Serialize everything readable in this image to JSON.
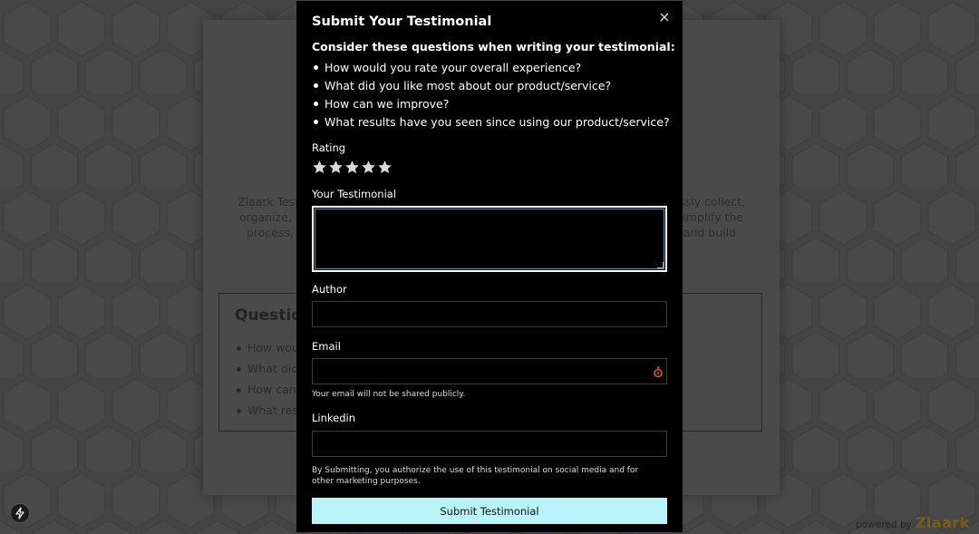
{
  "background_page": {
    "intro_text": "Zlaark Test                                                                         essly collect, organize, a                                                                   implify the process, y                                                                 and build",
    "intro_lines": [
      "Zlaark Test",
      "essly collect,",
      "organize, a",
      "implify the",
      "process, y",
      "and build"
    ],
    "questions_title": "Question",
    "questions": [
      "How wou",
      "What did",
      "How can",
      "What res"
    ]
  },
  "modal": {
    "title": "Submit Your Testimonial",
    "close_icon": "×",
    "questions_heading": "Consider these questions when writing your testimonial:",
    "questions": [
      "How would you rate your overall experience?",
      "What did you like most about our product/service?",
      "How can we improve?",
      "What results have you seen since using our product/service?"
    ],
    "rating_label": "Rating",
    "rating": {
      "value": 5,
      "max": 5
    },
    "testimonial_label": "Your Testimonial",
    "testimonial_value": "",
    "author_label": "Author",
    "author_value": "",
    "email_label": "Email",
    "email_value": "",
    "email_hint": "Your email will not be shared publicly.",
    "linkedin_label": "Linkedin",
    "linkedin_value": "",
    "legal_text": "By Submitting, you authorize the use of this testimonial on social media and for other marketing purposes.",
    "submit_label": "Submit Testimonial"
  },
  "footer": {
    "powered_by": "powered by",
    "brand": "Zlaark"
  },
  "colors": {
    "submit_bg": "#b8f4f8",
    "star": "#d9d9d9",
    "brand": "#7a5c14",
    "key_icon": "#e0503a"
  }
}
